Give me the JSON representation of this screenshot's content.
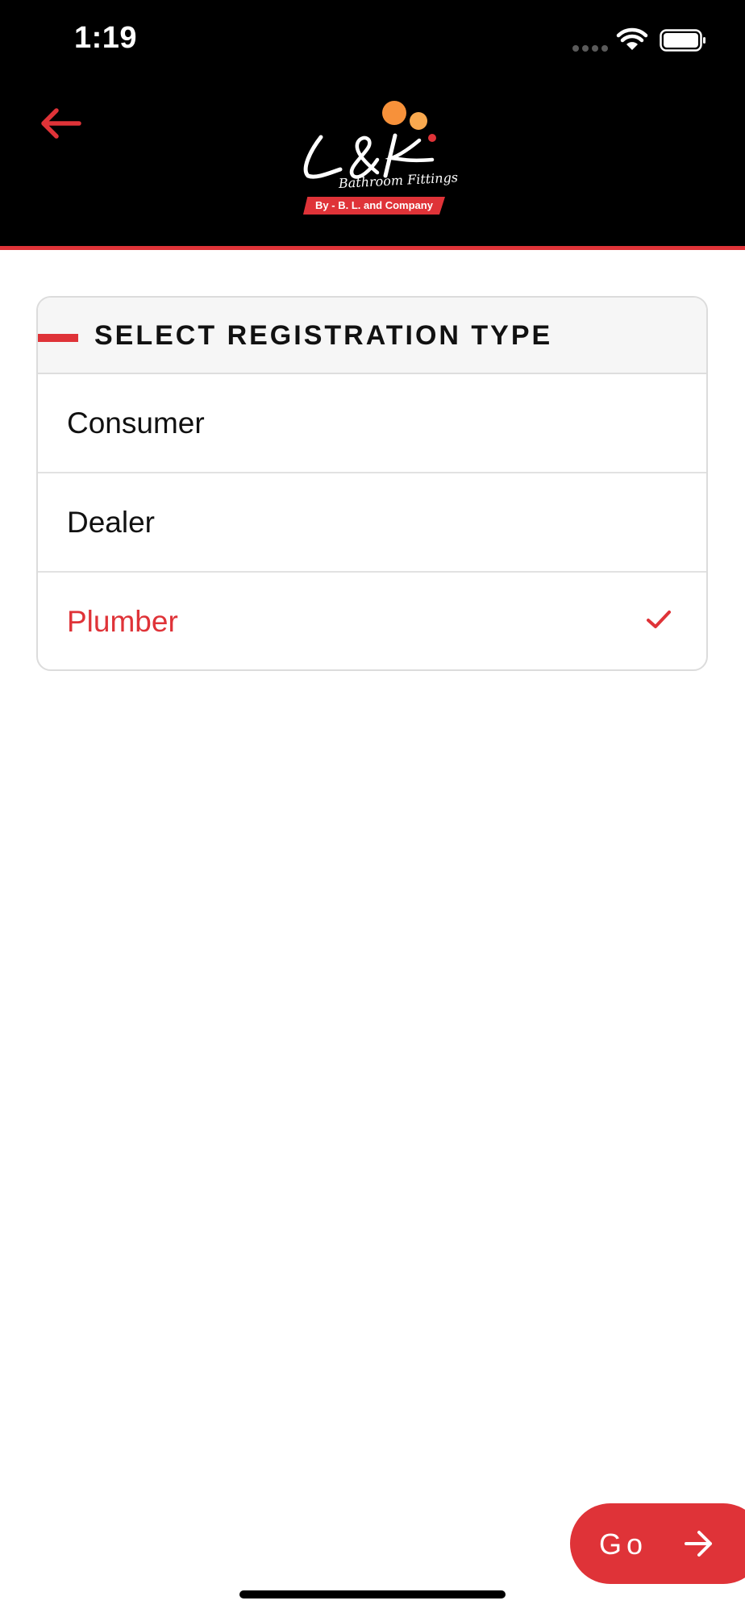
{
  "status_bar": {
    "time": "1:19",
    "icons": [
      "signal-dots-icon",
      "wifi-icon",
      "battery-icon"
    ]
  },
  "header": {
    "back_icon": "back-arrow-icon",
    "logo": {
      "brand": "L&K",
      "subtitle": "Bathroom Fittings",
      "banner": "By - B. L. and Company"
    }
  },
  "registration": {
    "title": "SELECT REGISTRATION TYPE",
    "options": [
      {
        "label": "Consumer",
        "selected": false
      },
      {
        "label": "Dealer",
        "selected": false
      },
      {
        "label": "Plumber",
        "selected": true
      }
    ]
  },
  "actions": {
    "go_label": "Go",
    "go_icon": "arrow-right-icon"
  },
  "colors": {
    "accent": "#df3338",
    "header_bg": "#000000",
    "logo_orange": "#f7913a",
    "logo_light_orange": "#f9a94f"
  }
}
